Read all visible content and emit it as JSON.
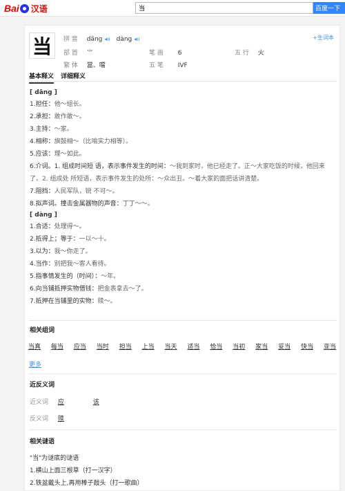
{
  "header": {
    "logo_bai": "Bai",
    "logo_hanyu": "汉语",
    "search_value": "当",
    "search_button": "百度一下"
  },
  "entry": {
    "character": "当",
    "add_wordbook": "+生词本",
    "pinyin_label": "拼 音",
    "pinyin1": "dāng",
    "pinyin2": "dàng",
    "radical_label": "部 首",
    "radical": "⺌",
    "strokes_label": "笔 画",
    "strokes": "6",
    "wuxing_label": "五 行",
    "wuxing": "火",
    "traditional_label": "繁 体",
    "traditional": "當、噹",
    "wubi_label": "五 笔",
    "wubi": "IVF"
  },
  "tabs": [
    "基本释义",
    "详细释义"
  ],
  "definitions": {
    "dang1_head": "[ dāng ]",
    "dang1": [
      {
        "main": "1.担任：",
        "ex": "他～组长。"
      },
      {
        "main": "2.承担：",
        "ex": "敢作敢～。"
      },
      {
        "main": "3.主持：",
        "ex": "～家。"
      },
      {
        "main": "4.相称：",
        "ex": "旗鼓相～（比喻实力相等）。"
      },
      {
        "main": "5.应该：",
        "ex": "理～如此。"
      },
      {
        "main": "6.介词。1. 组成时间短 语，表示事件发生的时间：",
        "ex": "～我到家时，他已经走了。正～大家吃饭的时候，他回来了。2. 组成处 所短语，表示事件发生的处所：～众出丑。～着大家的面把话讲清楚。"
      },
      {
        "main": "7.阻挡：",
        "ex": "人民军队，锐 不可～。"
      },
      {
        "main": "8.拟声词。撞击金属器物的声音：",
        "ex": "丁丁～～。"
      }
    ],
    "dang4_head": "[ dàng ]",
    "dang4": [
      {
        "main": "1.合适：",
        "ex": "处理得～。"
      },
      {
        "main": "2.抵得上；等于：",
        "ex": "一以～十。"
      },
      {
        "main": "3.以为：",
        "ex": "我～你走了。"
      },
      {
        "main": "4.当作：",
        "ex": "别把我～客人看待。"
      },
      {
        "main": "5.指事情发生的（时间）：",
        "ex": "～年。"
      },
      {
        "main": "6.向当铺抵押实物借钱：",
        "ex": "把金表拿去～了。"
      },
      {
        "main": "7.抵押在当铺里的实物：",
        "ex": "赎～。"
      }
    ]
  },
  "related_words": {
    "title": "相关组词",
    "words": [
      "当真",
      "每当",
      "应当",
      "当时",
      "担当",
      "上当",
      "当天",
      "适当",
      "恰当",
      "当初",
      "家当",
      "妥当",
      "快当",
      "亚当"
    ],
    "more": "更多"
  },
  "synonyms": {
    "title": "近反义词",
    "syn_label": "近义词",
    "syn_words": [
      "应",
      "该"
    ],
    "ant_label": "反义词",
    "ant_words": [
      "赎"
    ]
  },
  "riddles": {
    "title": "相关谜语",
    "intro": "\"当\"为谜底的谜语",
    "items": [
      "1.横山上面三根草（打一汉字）",
      "2.铁盆戴头上,再用棒子敲头（打一歌曲）"
    ]
  },
  "colors": {
    "accent": "#3385ff",
    "logo_red": "#e10601",
    "link_blue": "#3f8fe4"
  }
}
